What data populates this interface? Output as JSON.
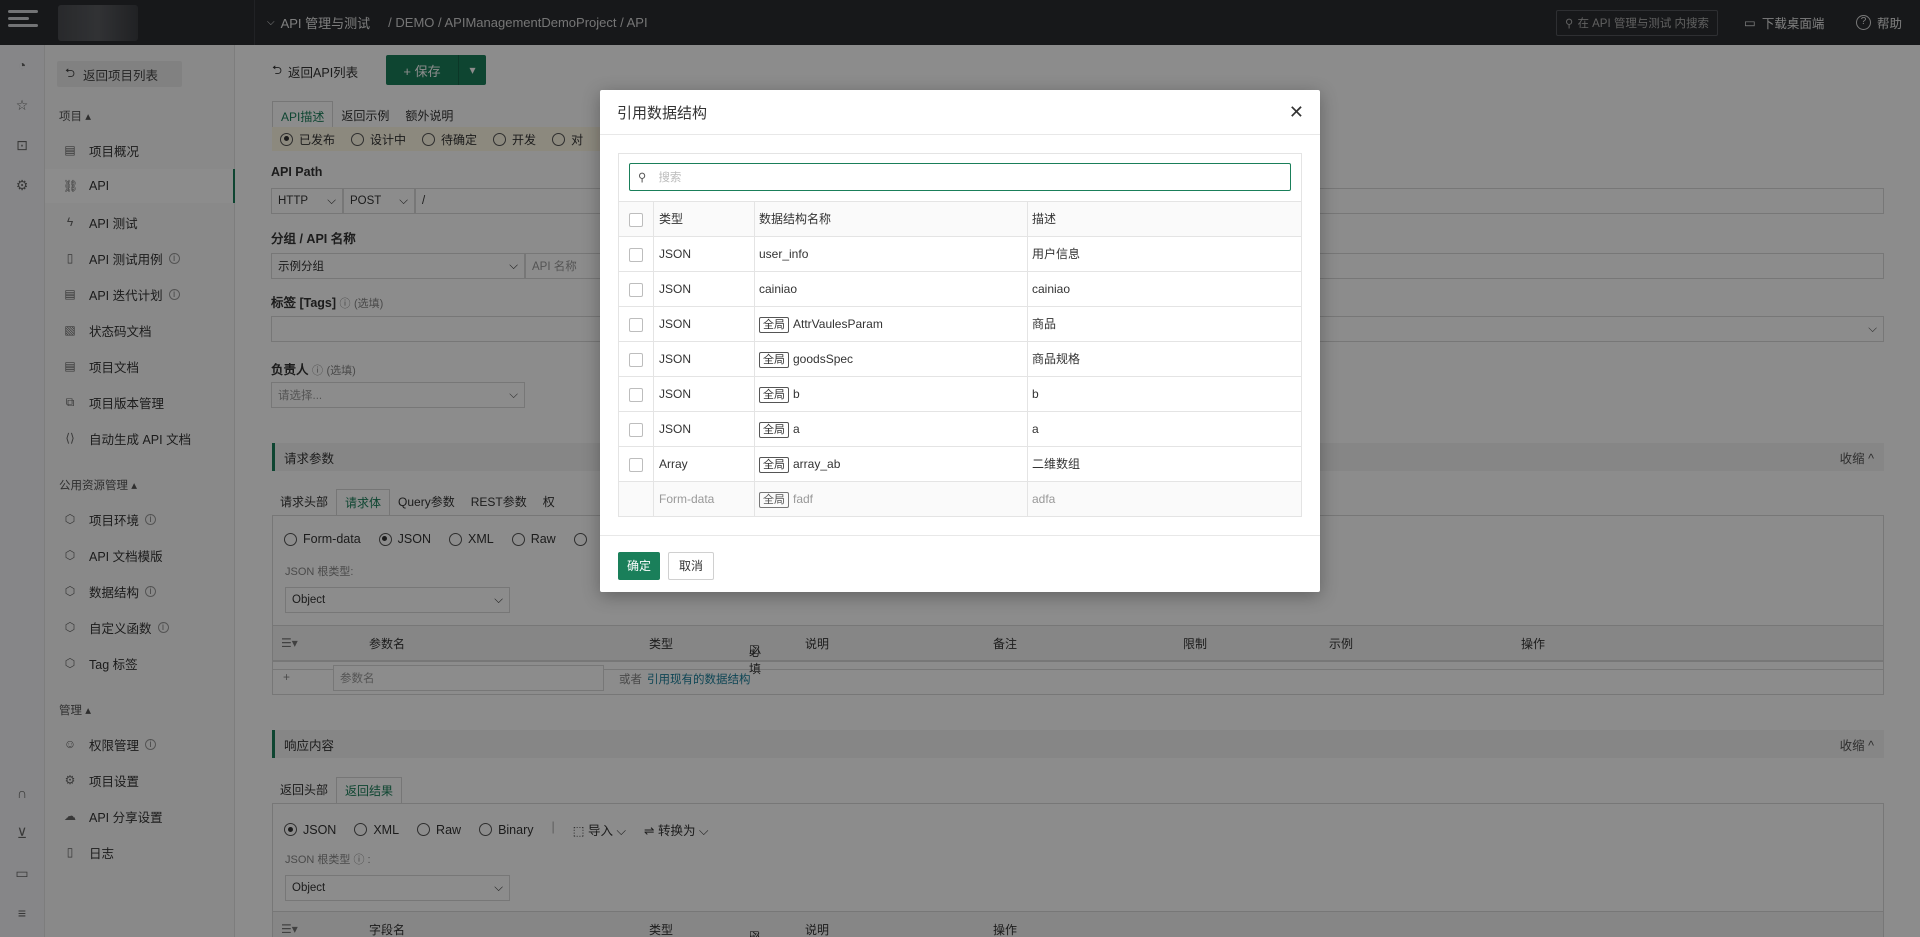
{
  "topbar": {
    "module": "API 管理与测试",
    "path": "/ DEMO / APIManagementDemoProject / API",
    "search_placeholder": "在 API 管理与测试 内搜索",
    "download": "下载桌面端",
    "help": "帮助"
  },
  "sidebar": {
    "back": "返回项目列表",
    "group_project": "项目",
    "group_common": "公用资源管理",
    "group_manage": "管理",
    "items": [
      {
        "label": "项目概况"
      },
      {
        "label": "API"
      },
      {
        "label": "API 测试"
      },
      {
        "label": "API 测试用例"
      },
      {
        "label": "API 迭代计划"
      },
      {
        "label": "状态码文档"
      },
      {
        "label": "项目文档"
      },
      {
        "label": "项目版本管理"
      },
      {
        "label": "自动生成 API 文档"
      },
      {
        "label": "项目环境"
      },
      {
        "label": "API 文档模版"
      },
      {
        "label": "数据结构"
      },
      {
        "label": "自定义函数"
      },
      {
        "label": "Tag 标签"
      },
      {
        "label": "权限管理"
      },
      {
        "label": "项目设置"
      },
      {
        "label": "API 分享设置"
      },
      {
        "label": "日志"
      }
    ]
  },
  "main": {
    "back": "返回API列表",
    "save": "保存",
    "tabs": [
      "API描述",
      "返回示例",
      "额外说明"
    ],
    "status": [
      "已发布",
      "设计中",
      "待确定",
      "开发",
      "对"
    ],
    "api_path_label": "API Path",
    "protocol": "HTTP",
    "method": "POST",
    "path_value": "/",
    "group_label": "分组 / API 名称",
    "group_value": "示例分组",
    "name_placeholder": "API 名称",
    "tags_label": "标签 [Tags]",
    "optional": "(选填)",
    "owner_label": "负责人",
    "owner_placeholder": "请选择...",
    "req_section": "请求参数",
    "collapse": "收缩",
    "req_tabs": [
      "请求头部",
      "请求体",
      "Query参数",
      "REST参数",
      "权"
    ],
    "body_types": [
      "Form-data",
      "JSON",
      "XML",
      "Raw",
      ""
    ],
    "json_type_label": "JSON 根类型:",
    "json_type_value": "Object",
    "param_cols": [
      "参数名",
      "类型",
      "必填",
      "说明",
      "备注",
      "限制",
      "示例",
      "操作"
    ],
    "param_placeholder": "参数名",
    "or_text": "或者",
    "ref_link": "引用现有的数据结构",
    "resp_section": "响应内容",
    "resp_tabs": [
      "返回头部",
      "返回结果"
    ],
    "resp_types": [
      "JSON",
      "XML",
      "Raw",
      "Binary"
    ],
    "import": "导入",
    "convert": "转换为",
    "resp_json_type_label": "JSON 根类型",
    "resp_json_type_value": "Object",
    "resp_cols": [
      "字段名",
      "类型",
      "必含",
      "说明",
      "操作"
    ]
  },
  "modal": {
    "title": "引用数据结构",
    "search_placeholder": "搜索",
    "cols": [
      "类型",
      "数据结构名称",
      "描述"
    ],
    "global_tag": "全局",
    "rows": [
      {
        "type": "JSON",
        "name": "user_info",
        "desc": "用户信息",
        "global": false
      },
      {
        "type": "JSON",
        "name": "cainiao",
        "desc": "cainiao",
        "global": false
      },
      {
        "type": "JSON",
        "name": "AttrVaulesParam",
        "desc": "商品",
        "global": true
      },
      {
        "type": "JSON",
        "name": "goodsSpec",
        "desc": "商品规格",
        "global": true
      },
      {
        "type": "JSON",
        "name": "b",
        "desc": "b",
        "global": true
      },
      {
        "type": "JSON",
        "name": "a",
        "desc": "a",
        "global": true
      },
      {
        "type": "Array",
        "name": "array_ab",
        "desc": "二维数组",
        "global": true
      },
      {
        "type": "Form-data",
        "name": "fadf",
        "desc": "adfa",
        "global": true
      }
    ],
    "confirm": "确定",
    "cancel": "取消"
  }
}
